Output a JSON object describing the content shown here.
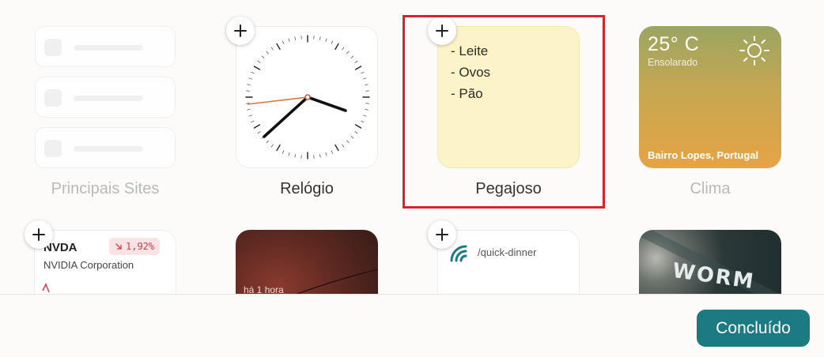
{
  "widgets": {
    "top_sites": {
      "label": "Principais Sites"
    },
    "clock": {
      "label": "Relógio"
    },
    "sticky": {
      "label": "Pegajoso",
      "lines": [
        "- Leite",
        "- Ovos",
        "- Pão"
      ]
    },
    "weather": {
      "label": "Clima",
      "temp": "25° C",
      "condition": "Ensolarado",
      "location": "Bairro Lopes, Portugal",
      "icon": "sun-icon"
    },
    "stock": {
      "ticker": "NVDA",
      "name": "NVIDIA Corporation",
      "change": "1,92%",
      "change_icon": "arrow-down-right-icon",
      "color": "#d13b4b"
    },
    "photo": {
      "caption": "há 1 hora"
    },
    "link": {
      "path": "/quick-dinner",
      "icon": "link-logo-icon"
    },
    "poster": {
      "text": "WORM"
    }
  },
  "add_icon": "plus-icon",
  "footer": {
    "done_label": "Concluído"
  },
  "colors": {
    "accent": "#1c7b82",
    "selection": "#d5242b",
    "sticky_bg": "#fdf3c8"
  }
}
